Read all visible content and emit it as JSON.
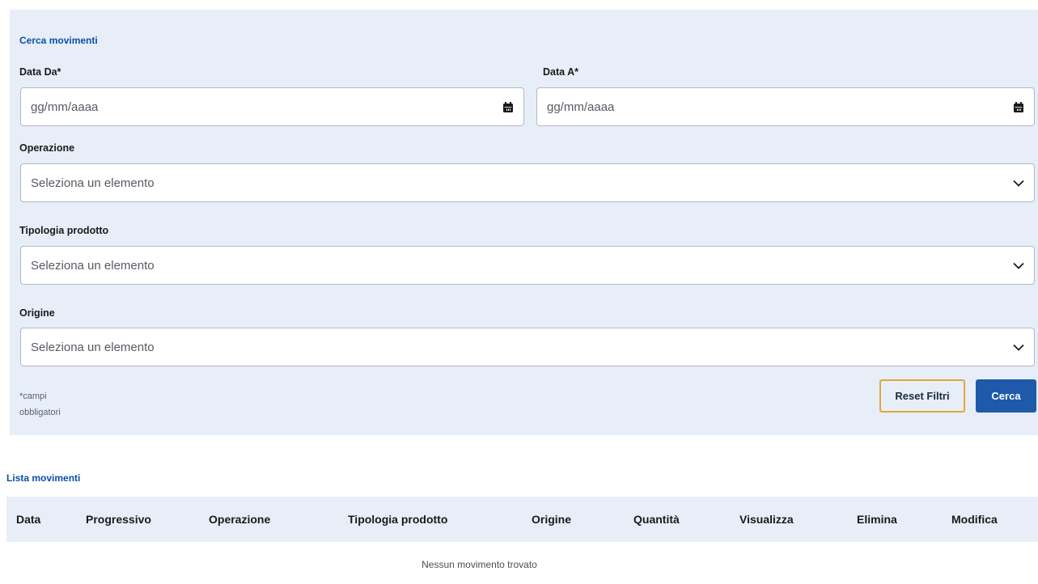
{
  "search": {
    "title": "Cerca movimenti",
    "date_from": {
      "label": "Data Da*",
      "placeholder": "gg/mm/aaaa",
      "icon": "calendar-icon"
    },
    "date_to": {
      "label": "Data A*",
      "placeholder": "gg/mm/aaaa",
      "icon": "calendar-icon"
    },
    "operation": {
      "label": "Operazione",
      "value": "Seleziona un elemento"
    },
    "product_type": {
      "label": "Tipologia prodotto",
      "value": "Seleziona un elemento"
    },
    "origin": {
      "label": "Origine",
      "value": "Seleziona un elemento"
    },
    "required_note": "*campi obbligatori",
    "reset_label": "Reset Filtri",
    "search_label": "Cerca"
  },
  "list": {
    "title": "Lista movimenti",
    "columns": [
      "Data",
      "Progressivo",
      "Operazione",
      "Tipologia prodotto",
      "Origine",
      "Quantità",
      "Visualizza",
      "Elimina",
      "Modifica"
    ],
    "empty_message": "Nessun movimento trovato"
  },
  "colors": {
    "panel_bg": "#e8eef7",
    "accent_blue": "#1f5aaa",
    "link_blue": "#0b4fa8",
    "reset_border": "#e0a63c"
  }
}
